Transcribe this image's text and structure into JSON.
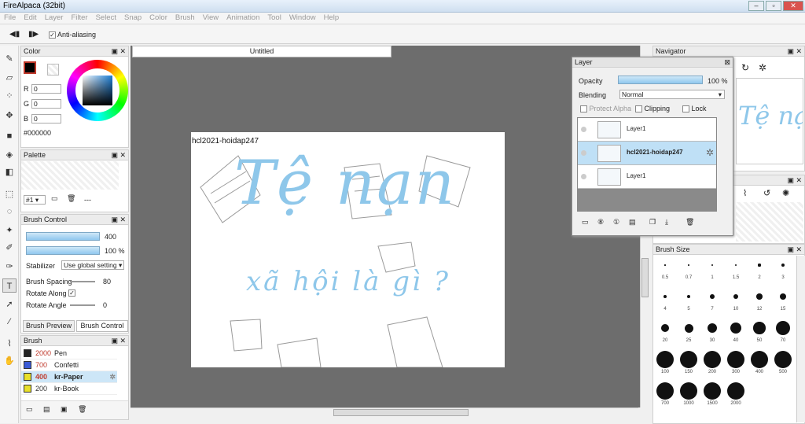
{
  "app": {
    "title": "FireAlpaca (32bit)"
  },
  "menu": [
    "File",
    "Edit",
    "Layer",
    "Filter",
    "Select",
    "Snap",
    "Color",
    "Brush",
    "View",
    "Animation",
    "Tool",
    "Window",
    "Help"
  ],
  "toolbar": {
    "anti_aliasing": "Anti-aliasing"
  },
  "canvas": {
    "tab": "Untitled",
    "watermark": "hcl2021-hoidap247",
    "art_line1": "Tệ nạn",
    "art_line2": "xã hội là gì ?"
  },
  "color_panel": {
    "title": "Color",
    "r_label": "R",
    "g_label": "G",
    "b_label": "B",
    "r": "0",
    "g": "0",
    "b": "0",
    "hex": "#000000",
    "accent": "#8ec7ea"
  },
  "palette_panel": {
    "title": "Palette",
    "index": "#1",
    "dash": "---"
  },
  "brush_control": {
    "title": "Brush Control",
    "size": "400",
    "opacity": "100 %",
    "stabilizer_label": "Stabilizer",
    "stabilizer_value": "Use global setting",
    "spacing_label": "Brush Spacing",
    "spacing_value": "80",
    "rotate_along_label": "Rotate Along",
    "rotate_angle_label": "Rotate Angle",
    "rotate_angle_value": "0",
    "tab_preview": "Brush Preview",
    "tab_control": "Brush Control"
  },
  "brush_panel": {
    "title": "Brush",
    "items": [
      {
        "size": "2000",
        "name": "Pen",
        "color": "#222222"
      },
      {
        "size": "700",
        "name": "Confetti",
        "color": "#3b5bd6"
      },
      {
        "size": "400",
        "name": "kr-Paper",
        "color": "#e8e02a"
      },
      {
        "size": "200",
        "name": "kr-Book",
        "color": "#e8e02a"
      }
    ]
  },
  "layer_panel": {
    "title": "Layer",
    "opacity_label": "Opacity",
    "opacity_value": "100 %",
    "blending_label": "Blending",
    "blending_value": "Normal",
    "protect_alpha": "Protect Alpha",
    "clipping": "Clipping",
    "lock": "Lock",
    "layers": [
      {
        "name": "Layer1",
        "selected": false
      },
      {
        "name": "hcl2021-hoidap247",
        "selected": true
      },
      {
        "name": "Layer1",
        "selected": false
      }
    ]
  },
  "navigator": {
    "title": "Navigator"
  },
  "brush_size": {
    "title": "Brush Size",
    "sizes": [
      "0.5",
      "0.7",
      "1",
      "1.5",
      "2",
      "3",
      "4",
      "5",
      "7",
      "10",
      "12",
      "15",
      "20",
      "25",
      "30",
      "40",
      "50",
      "70",
      "100",
      "150",
      "200",
      "300",
      "400",
      "500",
      "700",
      "1000",
      "1500",
      "2000"
    ]
  }
}
